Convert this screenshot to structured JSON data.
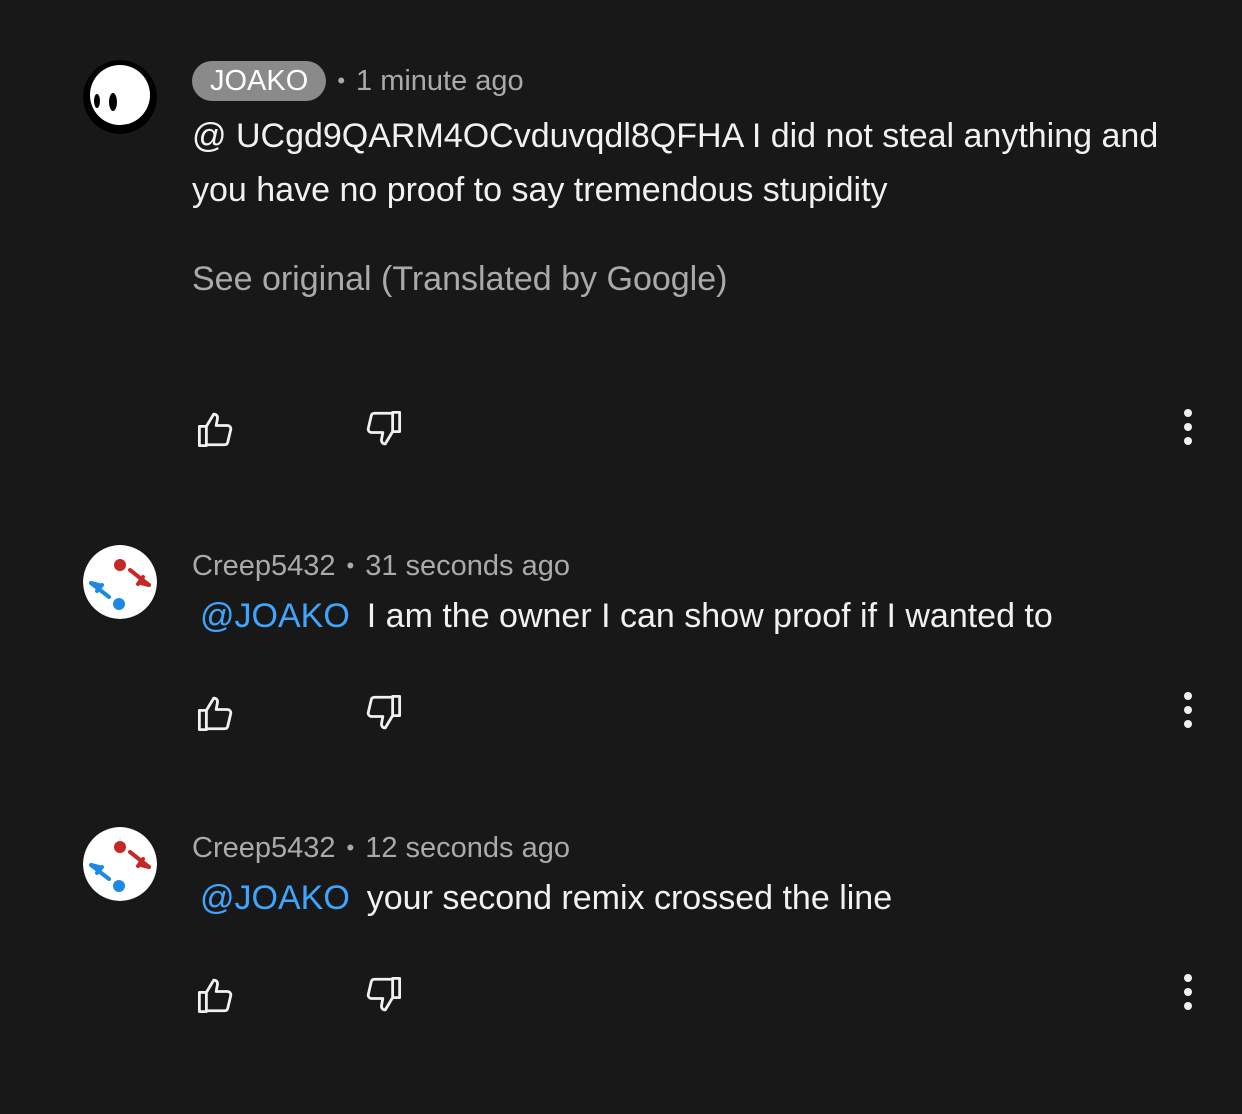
{
  "comments": [
    {
      "author": "JOAKO",
      "author_highlighted": true,
      "separator": "•",
      "time": "1 minute ago",
      "text": "@ UCgd9QARM4OCvduvqdl8QFHA I did not steal anything and you have no proof to say tremendous stupidity",
      "translation_link": "See original (Translated by Google)",
      "avatar_icon": "white-ghost-avatar",
      "like_icon": "thumb-up-icon",
      "dislike_icon": "thumb-down-icon",
      "menu_icon": "more-vert-icon"
    },
    {
      "author": "Creep5432",
      "author_highlighted": false,
      "separator": "•",
      "time": "31 seconds ago",
      "mention": "@JOAKO",
      "text": "I am the owner I can show proof if I wanted to",
      "avatar_icon": "red-blue-pins-avatar",
      "like_icon": "thumb-up-icon",
      "dislike_icon": "thumb-down-icon",
      "menu_icon": "more-vert-icon"
    },
    {
      "author": "Creep5432",
      "author_highlighted": false,
      "separator": "•",
      "time": "12 seconds ago",
      "mention": "@JOAKO",
      "text": "your second remix crossed the line",
      "avatar_icon": "red-blue-pins-avatar",
      "like_icon": "thumb-up-icon",
      "dislike_icon": "thumb-down-icon",
      "menu_icon": "more-vert-icon"
    }
  ],
  "colors": {
    "background": "#181818",
    "text_primary": "#f1f1f1",
    "text_secondary": "#aaaaaa",
    "mention_link": "#3ea6ff",
    "author_pill": "#8a8a8a"
  }
}
